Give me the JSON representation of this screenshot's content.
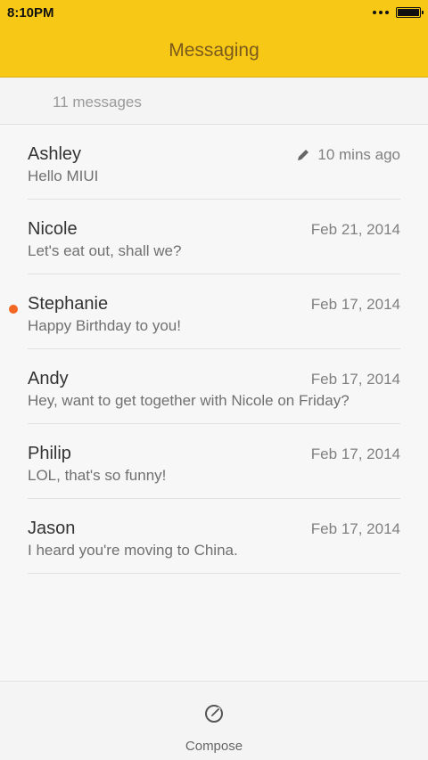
{
  "status_bar": {
    "time": "8:10PM"
  },
  "header": {
    "title": "Messaging"
  },
  "summary": {
    "count_text": "11 messages"
  },
  "threads": [
    {
      "name": "Ashley",
      "snippet": "Hello MIUI",
      "time": "10 mins ago",
      "unread": false,
      "draft": true
    },
    {
      "name": "Nicole",
      "snippet": "Let's eat out, shall we?",
      "time": "Feb 21, 2014",
      "unread": false,
      "draft": false
    },
    {
      "name": "Stephanie",
      "snippet": "Happy Birthday to you!",
      "time": "Feb 17, 2014",
      "unread": true,
      "draft": false
    },
    {
      "name": "Andy",
      "snippet": "Hey, want to get together with Nicole on Friday?",
      "time": "Feb 17, 2014",
      "unread": false,
      "draft": false
    },
    {
      "name": "Philip",
      "snippet": "LOL, that's so funny!",
      "time": "Feb 17, 2014",
      "unread": false,
      "draft": false
    },
    {
      "name": "Jason",
      "snippet": "I heard you're moving to China.",
      "time": "Feb 17, 2014",
      "unread": false,
      "draft": false
    }
  ],
  "bottom_bar": {
    "compose_label": "Compose"
  },
  "icons": {
    "draft": "pencil-icon",
    "compose": "compose-icon",
    "unread": "unread-dot"
  },
  "colors": {
    "header_bg": "#f8c816",
    "title": "#7a5b1c",
    "unread_dot": "#f26722"
  }
}
